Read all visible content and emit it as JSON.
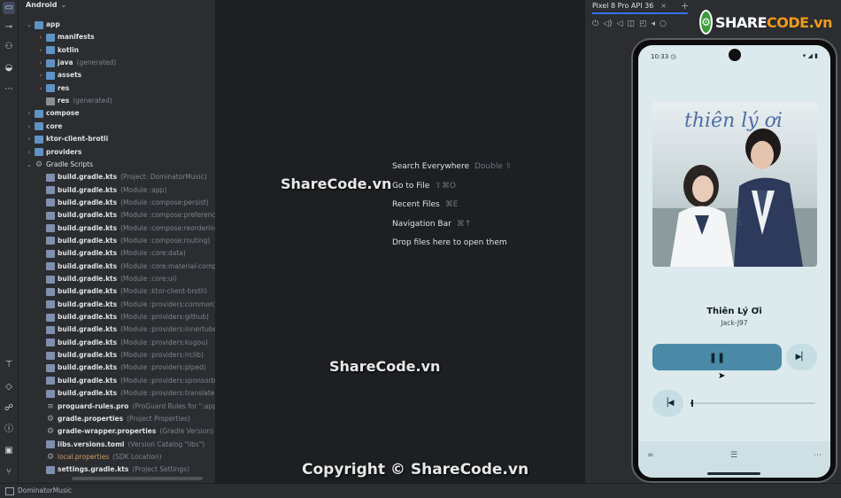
{
  "project_panel": {
    "title": "Android",
    "tree": [
      {
        "name": "app",
        "note": "",
        "level": 1,
        "arrow": "open",
        "icon": "folder",
        "bold": true
      },
      {
        "name": "manifests",
        "note": "",
        "level": 2,
        "arrow": "closed",
        "icon": "folder",
        "bold": true
      },
      {
        "name": "kotlin",
        "note": "",
        "level": 2,
        "arrow": "closed",
        "icon": "folder",
        "bold": true
      },
      {
        "name": "java",
        "note": "(generated)",
        "level": 2,
        "arrow": "closed",
        "icon": "folder",
        "bold": true
      },
      {
        "name": "assets",
        "note": "",
        "level": 2,
        "arrow": "closed",
        "icon": "folder",
        "bold": true
      },
      {
        "name": "res",
        "note": "",
        "level": 2,
        "arrow": "closed",
        "icon": "folder",
        "bold": true
      },
      {
        "name": "res",
        "note": "(generated)",
        "level": 2,
        "arrow": "none",
        "icon": "folder-gray",
        "bold": true
      },
      {
        "name": "compose",
        "note": "",
        "level": 1,
        "arrow": "closed",
        "icon": "folder",
        "bold": true
      },
      {
        "name": "core",
        "note": "",
        "level": 1,
        "arrow": "closed",
        "icon": "folder",
        "bold": true
      },
      {
        "name": "ktor-client-brotli",
        "note": "",
        "level": 1,
        "arrow": "closed",
        "icon": "folder",
        "bold": true
      },
      {
        "name": "providers",
        "note": "",
        "level": 1,
        "arrow": "closed",
        "icon": "folder",
        "bold": true
      },
      {
        "name": "Gradle Scripts",
        "note": "",
        "level": 1,
        "arrow": "open",
        "icon": "gear",
        "bold": false
      },
      {
        "name": "build.gradle.kts",
        "note": "(Project: DominatorMusic)",
        "level": 2,
        "arrow": "none",
        "icon": "file",
        "bold": true
      },
      {
        "name": "build.gradle.kts",
        "note": "(Module :app)",
        "level": 2,
        "arrow": "none",
        "icon": "file",
        "bold": true
      },
      {
        "name": "build.gradle.kts",
        "note": "(Module :compose:persist)",
        "level": 2,
        "arrow": "none",
        "icon": "file",
        "bold": true
      },
      {
        "name": "build.gradle.kts",
        "note": "(Module :compose:preferenc",
        "level": 2,
        "arrow": "none",
        "icon": "file",
        "bold": true
      },
      {
        "name": "build.gradle.kts",
        "note": "(Module :compose:reordering",
        "level": 2,
        "arrow": "none",
        "icon": "file",
        "bold": true
      },
      {
        "name": "build.gradle.kts",
        "note": "(Module :compose:routing)",
        "level": 2,
        "arrow": "none",
        "icon": "file",
        "bold": true
      },
      {
        "name": "build.gradle.kts",
        "note": "(Module :core:data)",
        "level": 2,
        "arrow": "none",
        "icon": "file",
        "bold": true
      },
      {
        "name": "build.gradle.kts",
        "note": "(Module :core:material-comp",
        "level": 2,
        "arrow": "none",
        "icon": "file",
        "bold": true
      },
      {
        "name": "build.gradle.kts",
        "note": "(Module :core:ui)",
        "level": 2,
        "arrow": "none",
        "icon": "file",
        "bold": true
      },
      {
        "name": "build.gradle.kts",
        "note": "(Module :ktor-client-brotli)",
        "level": 2,
        "arrow": "none",
        "icon": "file",
        "bold": true
      },
      {
        "name": "build.gradle.kts",
        "note": "(Module :providers:common)",
        "level": 2,
        "arrow": "none",
        "icon": "file",
        "bold": true
      },
      {
        "name": "build.gradle.kts",
        "note": "(Module :providers:github)",
        "level": 2,
        "arrow": "none",
        "icon": "file",
        "bold": true
      },
      {
        "name": "build.gradle.kts",
        "note": "(Module :providers:innertube",
        "level": 2,
        "arrow": "none",
        "icon": "file",
        "bold": true
      },
      {
        "name": "build.gradle.kts",
        "note": "(Module :providers:kugou)",
        "level": 2,
        "arrow": "none",
        "icon": "file",
        "bold": true
      },
      {
        "name": "build.gradle.kts",
        "note": "(Module :providers:lrclib)",
        "level": 2,
        "arrow": "none",
        "icon": "file",
        "bold": true
      },
      {
        "name": "build.gradle.kts",
        "note": "(Module :providers:piped)",
        "level": 2,
        "arrow": "none",
        "icon": "file",
        "bold": true
      },
      {
        "name": "build.gradle.kts",
        "note": "(Module :providers:sponsorb",
        "level": 2,
        "arrow": "none",
        "icon": "file",
        "bold": true
      },
      {
        "name": "build.gradle.kts",
        "note": "(Module :providers:translate)",
        "level": 2,
        "arrow": "none",
        "icon": "file",
        "bold": true
      },
      {
        "name": "proguard-rules.pro",
        "note": "(ProGuard Rules for \":app",
        "level": 2,
        "arrow": "none",
        "icon": "list",
        "bold": true
      },
      {
        "name": "gradle.properties",
        "note": "(Project Properties)",
        "level": 2,
        "arrow": "none",
        "icon": "gear",
        "bold": true
      },
      {
        "name": "gradle-wrapper.properties",
        "note": "(Gradle Version)",
        "level": 2,
        "arrow": "none",
        "icon": "gear",
        "bold": true
      },
      {
        "name": "libs.versions.toml",
        "note": "(Version Catalog \"libs\")",
        "level": 2,
        "arrow": "none",
        "icon": "file",
        "bold": true
      },
      {
        "name": "local.properties",
        "note": "(SDK Location)",
        "level": 2,
        "arrow": "none",
        "icon": "gear",
        "orange": true
      },
      {
        "name": "settings.gradle.kts",
        "note": "(Project Settings)",
        "level": 2,
        "arrow": "none",
        "icon": "file",
        "bold": true
      }
    ]
  },
  "editor": {
    "hints": [
      {
        "label": "Search Everywhere",
        "shortcut": "Double ⇧"
      },
      {
        "label": "Go to File",
        "shortcut": "⇧⌘O"
      },
      {
        "label": "Recent Files",
        "shortcut": "⌘E"
      },
      {
        "label": "Navigation Bar",
        "shortcut": "⌘↑"
      },
      {
        "label": "Drop files here to open them",
        "shortcut": ""
      }
    ]
  },
  "emulator": {
    "tab_label": "Pixel 8 Pro API 36",
    "phone": {
      "time": "10:33",
      "album_text": "thiên lý ơi",
      "song_title": "Thiên Lý Ơi",
      "artist": "Jack-J97",
      "progress": 0.01
    }
  },
  "watermarks": {
    "logo": "SHARECODE.vn",
    "logo_share": "SHARE",
    "logo_code": "CODE.vn",
    "center_top": "ShareCode.vn",
    "center_mid": "ShareCode.vn",
    "copyright": "Copyright © ShareCode.vn"
  },
  "status_bar": {
    "project_name": "DominatorMusic"
  },
  "colors": {
    "accent": "#3574f0",
    "folder": "#5e93c5",
    "player_primary": "#4a8aa6",
    "player_bg": "#dceaee"
  }
}
